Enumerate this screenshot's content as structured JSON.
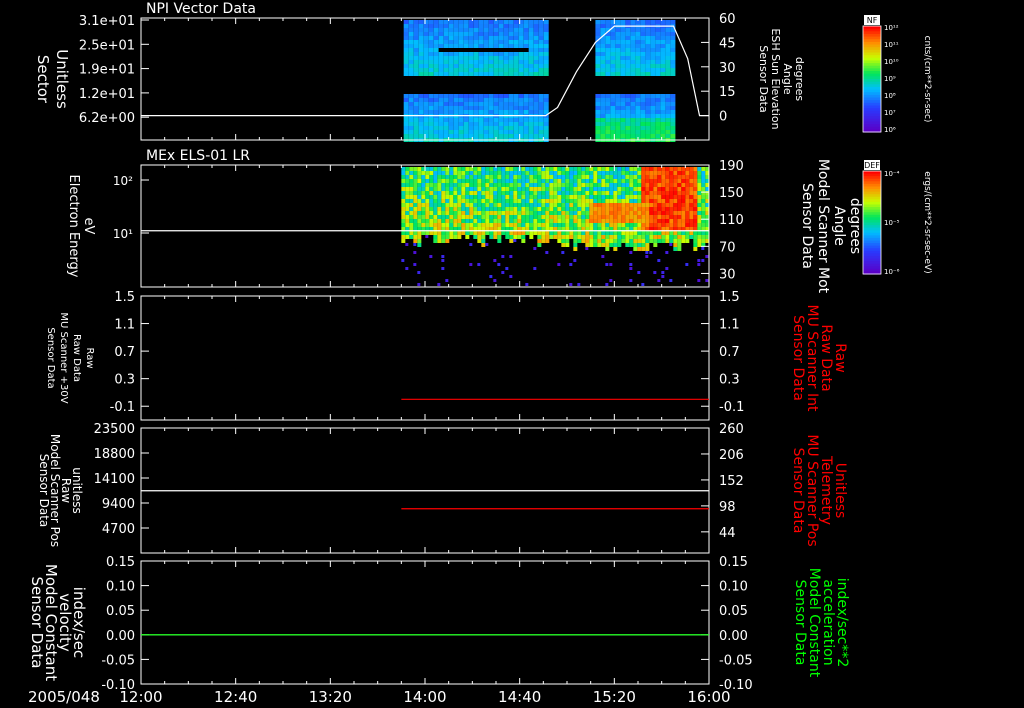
{
  "date_label": "2005/048",
  "time_ticks": [
    "12:00",
    "12:40",
    "13:20",
    "14:00",
    "14:40",
    "15:20",
    "16:00"
  ],
  "colors": {
    "background": "#000000",
    "axes": "#ffffff",
    "trace_white": "#ffffff",
    "trace_red": "#ff0000",
    "trace_green": "#00ff00"
  },
  "colorbars": [
    {
      "label": "NF",
      "unit": "cnts/(cm**2-sr-sec)",
      "tick_labels": [
        "10¹²",
        "10¹¹",
        "10¹⁰",
        "10⁹",
        "10⁸",
        "10⁷",
        "10⁶"
      ]
    },
    {
      "label": "DEF",
      "unit": "ergs/(cm**2-sr-sec-eV)",
      "tick_labels": [
        "10⁻⁴",
        "10⁻⁵",
        "10⁻⁶"
      ]
    }
  ],
  "chart_data": [
    {
      "type": "heatmap",
      "title": "NPI Vector Data",
      "ylabel": [
        "Sector",
        "Unitless"
      ],
      "ytick_labels": [
        "3.1e+01",
        "2.5e+01",
        "1.9e+01",
        "1.2e+01",
        "6.2e+00"
      ],
      "ylim": [
        0,
        31
      ],
      "right_ylabel": [
        "Sensor Data",
        "ESH Sun Elevation",
        "Angle",
        "degrees"
      ],
      "right_ylim": [
        -15,
        60
      ],
      "right_yticks": [
        60,
        45,
        30,
        15,
        0
      ],
      "data_intervals": [
        [
          "13:51",
          "14:51"
        ],
        [
          "15:12",
          "15:45"
        ]
      ],
      "colorbar": "NF",
      "series": [
        {
          "name": "ESH Sun Elevation Angle",
          "axis": "right",
          "color": "white",
          "x": [
            "12:00",
            "14:51",
            "14:56",
            "15:04",
            "15:12",
            "15:20",
            "15:45",
            "15:51",
            "15:56",
            "16:00"
          ],
          "y": [
            0,
            0,
            5,
            27,
            45,
            55,
            55,
            35,
            0,
            0
          ]
        }
      ]
    },
    {
      "type": "heatmap",
      "title": "MEx ELS-01 LR",
      "ylabel": [
        "Electron Energy",
        "eV"
      ],
      "yscale": "log",
      "ytick_labels": [
        "10²",
        "10¹"
      ],
      "ylim": [
        1,
        200
      ],
      "right_ylabel": [
        "Sensor Data",
        "Model Scanner Mot",
        "Angle",
        "degrees"
      ],
      "right_ylim": [
        10,
        190
      ],
      "right_yticks": [
        190,
        150,
        110,
        70,
        30
      ],
      "data_interval": [
        "13:50",
        "16:00"
      ],
      "colorbar": "DEF",
      "series": [
        {
          "name": "Model Scanner Angle",
          "axis": "right",
          "color": "white",
          "x": [
            "12:00",
            "16:00"
          ],
          "y": [
            93,
            93
          ]
        }
      ]
    },
    {
      "type": "line",
      "ylabel": [
        "Sensor Data",
        "MU Scanner +30V",
        "Raw Data",
        "Raw"
      ],
      "ylim": [
        -0.3,
        1.5
      ],
      "yticks": [
        1.5,
        1.1,
        0.7,
        0.3,
        -0.1
      ],
      "ytick_labels": [
        "1.5",
        "1.1",
        "0.7",
        "0.3",
        "-0.1"
      ],
      "right_ylabel": [
        "Sensor Data",
        "MU Scanner Int",
        "Raw Data",
        "Raw"
      ],
      "right_ylim": [
        -0.3,
        1.5
      ],
      "right_yticks": [
        1.5,
        1.1,
        0.7,
        0.3,
        -0.1
      ],
      "right_ytick_labels": [
        "1.5",
        "1.1",
        "0.7",
        "0.3",
        "-0.1"
      ],
      "series": [
        {
          "name": "MU Scanner Int",
          "axis": "right",
          "color": "red",
          "x": [
            "13:50",
            "16:00"
          ],
          "y": [
            0,
            0
          ]
        }
      ]
    },
    {
      "type": "line",
      "ylabel": [
        "Sensor Data",
        "Model Scanner Pos",
        "Raw",
        "unitless"
      ],
      "ylim": [
        0,
        23500
      ],
      "yticks": [
        23500,
        18800,
        14100,
        9400,
        4700
      ],
      "ytick_labels": [
        "23500",
        "18800",
        "14100",
        "9400",
        "4700"
      ],
      "right_ylabel": [
        "Sensor Data",
        "MU Scanner Pos",
        "Telemetry",
        "Unitless"
      ],
      "right_ylim": [
        0,
        260
      ],
      "right_yticks": [
        260,
        206,
        152,
        98,
        44
      ],
      "right_ytick_labels": [
        "260",
        "206",
        "152",
        "98",
        "44"
      ],
      "series": [
        {
          "name": "Model Scanner Pos",
          "axis": "left",
          "color": "white",
          "x": [
            "12:00",
            "16:00"
          ],
          "y": [
            11700,
            11700
          ]
        },
        {
          "name": "MU Scanner Pos",
          "axis": "right",
          "color": "red",
          "x": [
            "13:50",
            "16:00"
          ],
          "y": [
            92,
            92
          ]
        }
      ]
    },
    {
      "type": "line",
      "ylabel": [
        "Sensor Data",
        "Model Constant",
        "velocity",
        "index/sec"
      ],
      "ylim": [
        -0.1,
        0.15
      ],
      "yticks": [
        0.15,
        0.1,
        0.05,
        0,
        -0.05,
        -0.1
      ],
      "ytick_labels": [
        "0.15",
        "0.10",
        "0.05",
        "0.00",
        "-0.05",
        "-0.10"
      ],
      "right_ylabel": [
        "Sensor Data",
        "Model Constant",
        "acceleration",
        "index/sec**2"
      ],
      "right_ylim": [
        -0.1,
        0.15
      ],
      "right_yticks": [
        0.15,
        0.1,
        0.05,
        0,
        -0.05,
        -0.1
      ],
      "right_ytick_labels": [
        "0.15",
        "0.10",
        "0.05",
        "0.00",
        "-0.05",
        "-0.10"
      ],
      "series": [
        {
          "name": "Model Constant velocity",
          "axis": "left",
          "color": "white",
          "x": [
            "12:00",
            "16:00"
          ],
          "y": [
            0,
            0
          ]
        },
        {
          "name": "Model Constant acceleration",
          "axis": "right",
          "color": "green",
          "x": [
            "12:00",
            "16:00"
          ],
          "y": [
            0,
            0
          ]
        }
      ]
    }
  ]
}
